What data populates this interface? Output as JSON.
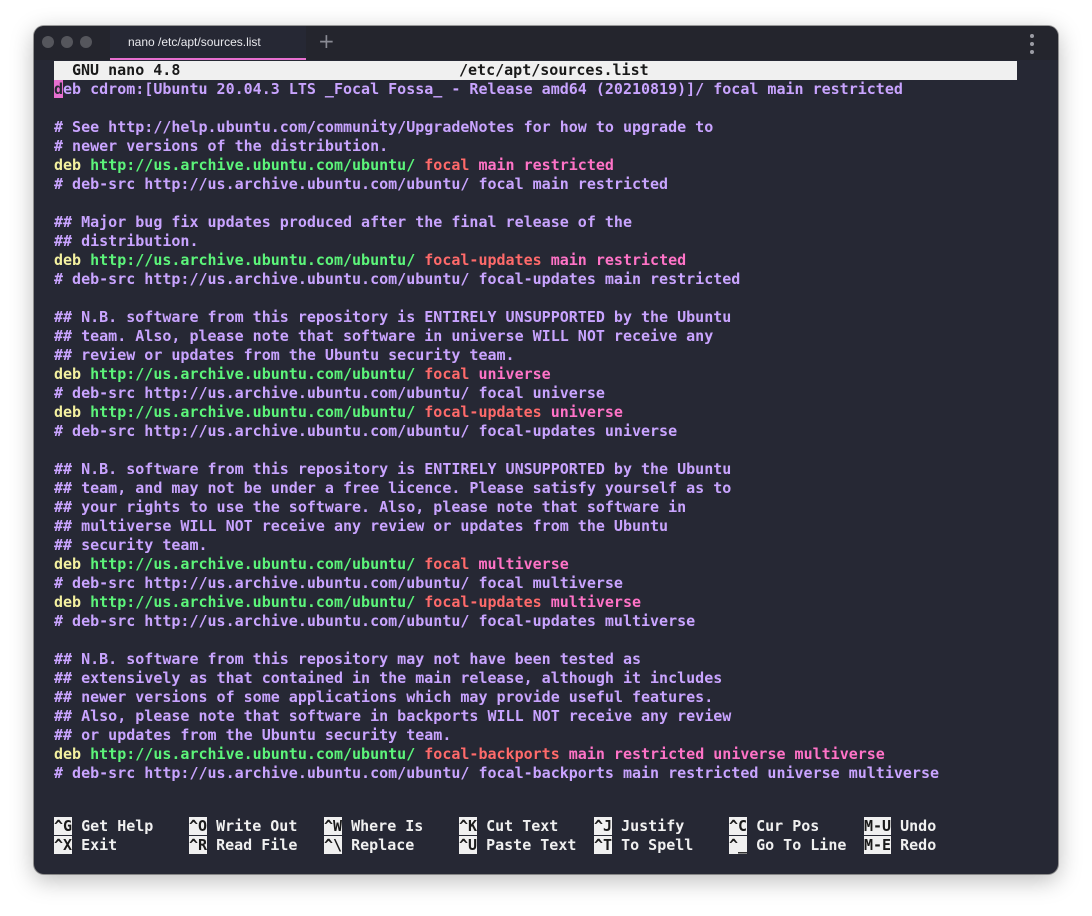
{
  "window": {
    "tab_title": "nano /etc/apt/sources.list",
    "new_tab": "+"
  },
  "nano": {
    "version": "GNU nano 4.8",
    "filename": "/etc/apt/sources.list"
  },
  "lines": [
    [
      {
        "t": "d",
        "c": "cursor"
      },
      {
        "t": "eb cdrom:[Ubuntu 20.04.3 LTS _Focal Fossa_ - Release amd64 (20210819)]/ focal main restricted",
        "c": "c-cdrom"
      }
    ],
    [],
    [
      {
        "t": "# See http://help.ubuntu.com/community/UpgradeNotes for how to upgrade to",
        "c": "c-comment"
      }
    ],
    [
      {
        "t": "# newer versions of the distribution.",
        "c": "c-comment"
      }
    ],
    [
      {
        "t": "deb ",
        "c": "c-deb"
      },
      {
        "t": "http://us.archive.ubuntu.com/ubuntu/ ",
        "c": "c-url"
      },
      {
        "t": "focal ",
        "c": "c-suite"
      },
      {
        "t": "main restricted",
        "c": "c-comp"
      }
    ],
    [
      {
        "t": "# deb-src http://us.archive.ubuntu.com/ubuntu/ focal main restricted",
        "c": "c-comment"
      }
    ],
    [],
    [
      {
        "t": "## Major bug fix updates produced after the final release of the",
        "c": "c-comment"
      }
    ],
    [
      {
        "t": "## distribution.",
        "c": "c-comment"
      }
    ],
    [
      {
        "t": "deb ",
        "c": "c-deb"
      },
      {
        "t": "http://us.archive.ubuntu.com/ubuntu/ ",
        "c": "c-url"
      },
      {
        "t": "focal-updates ",
        "c": "c-suite"
      },
      {
        "t": "main restricted",
        "c": "c-comp"
      }
    ],
    [
      {
        "t": "# deb-src http://us.archive.ubuntu.com/ubuntu/ focal-updates main restricted",
        "c": "c-comment"
      }
    ],
    [],
    [
      {
        "t": "## N.B. software from this repository is ENTIRELY UNSUPPORTED by the Ubuntu",
        "c": "c-comment"
      }
    ],
    [
      {
        "t": "## team. Also, please note that software in universe WILL NOT receive any",
        "c": "c-comment"
      }
    ],
    [
      {
        "t": "## review or updates from the Ubuntu security team.",
        "c": "c-comment"
      }
    ],
    [
      {
        "t": "deb ",
        "c": "c-deb"
      },
      {
        "t": "http://us.archive.ubuntu.com/ubuntu/ ",
        "c": "c-url"
      },
      {
        "t": "focal ",
        "c": "c-suite"
      },
      {
        "t": "universe",
        "c": "c-comp"
      }
    ],
    [
      {
        "t": "# deb-src http://us.archive.ubuntu.com/ubuntu/ focal universe",
        "c": "c-comment"
      }
    ],
    [
      {
        "t": "deb ",
        "c": "c-deb"
      },
      {
        "t": "http://us.archive.ubuntu.com/ubuntu/ ",
        "c": "c-url"
      },
      {
        "t": "focal-updates ",
        "c": "c-suite"
      },
      {
        "t": "universe",
        "c": "c-comp"
      }
    ],
    [
      {
        "t": "# deb-src http://us.archive.ubuntu.com/ubuntu/ focal-updates universe",
        "c": "c-comment"
      }
    ],
    [],
    [
      {
        "t": "## N.B. software from this repository is ENTIRELY UNSUPPORTED by the Ubuntu",
        "c": "c-comment"
      }
    ],
    [
      {
        "t": "## team, and may not be under a free licence. Please satisfy yourself as to",
        "c": "c-comment"
      }
    ],
    [
      {
        "t": "## your rights to use the software. Also, please note that software in",
        "c": "c-comment"
      }
    ],
    [
      {
        "t": "## multiverse WILL NOT receive any review or updates from the Ubuntu",
        "c": "c-comment"
      }
    ],
    [
      {
        "t": "## security team.",
        "c": "c-comment"
      }
    ],
    [
      {
        "t": "deb ",
        "c": "c-deb"
      },
      {
        "t": "http://us.archive.ubuntu.com/ubuntu/ ",
        "c": "c-url"
      },
      {
        "t": "focal ",
        "c": "c-suite"
      },
      {
        "t": "multiverse",
        "c": "c-comp"
      }
    ],
    [
      {
        "t": "# deb-src http://us.archive.ubuntu.com/ubuntu/ focal multiverse",
        "c": "c-comment"
      }
    ],
    [
      {
        "t": "deb ",
        "c": "c-deb"
      },
      {
        "t": "http://us.archive.ubuntu.com/ubuntu/ ",
        "c": "c-url"
      },
      {
        "t": "focal-updates ",
        "c": "c-suite"
      },
      {
        "t": "multiverse",
        "c": "c-comp"
      }
    ],
    [
      {
        "t": "# deb-src http://us.archive.ubuntu.com/ubuntu/ focal-updates multiverse",
        "c": "c-comment"
      }
    ],
    [],
    [
      {
        "t": "## N.B. software from this repository may not have been tested as",
        "c": "c-comment"
      }
    ],
    [
      {
        "t": "## extensively as that contained in the main release, although it includes",
        "c": "c-comment"
      }
    ],
    [
      {
        "t": "## newer versions of some applications which may provide useful features.",
        "c": "c-comment"
      }
    ],
    [
      {
        "t": "## Also, please note that software in backports WILL NOT receive any review",
        "c": "c-comment"
      }
    ],
    [
      {
        "t": "## or updates from the Ubuntu security team.",
        "c": "c-comment"
      }
    ],
    [
      {
        "t": "deb ",
        "c": "c-deb"
      },
      {
        "t": "http://us.archive.ubuntu.com/ubuntu/ ",
        "c": "c-url"
      },
      {
        "t": "focal-backports ",
        "c": "c-suite"
      },
      {
        "t": "main restricted universe multiverse",
        "c": "c-comp"
      }
    ],
    [
      {
        "t": "# deb-src http://us.archive.ubuntu.com/ubuntu/ focal-backports main restricted universe multiverse",
        "c": "c-comment"
      }
    ]
  ],
  "shortcuts": [
    [
      {
        "key": "^G",
        "label": "Get Help"
      },
      {
        "key": "^X",
        "label": "Exit"
      }
    ],
    [
      {
        "key": "^O",
        "label": "Write Out"
      },
      {
        "key": "^R",
        "label": "Read File"
      }
    ],
    [
      {
        "key": "^W",
        "label": "Where Is"
      },
      {
        "key": "^\\",
        "label": "Replace"
      }
    ],
    [
      {
        "key": "^K",
        "label": "Cut Text"
      },
      {
        "key": "^U",
        "label": "Paste Text"
      }
    ],
    [
      {
        "key": "^J",
        "label": "Justify"
      },
      {
        "key": "^T",
        "label": "To Spell"
      }
    ],
    [
      {
        "key": "^C",
        "label": "Cur Pos"
      },
      {
        "key": "^_",
        "label": "Go To Line"
      }
    ],
    [
      {
        "key": "M-U",
        "label": "Undo"
      },
      {
        "key": "M-E",
        "label": "Redo"
      }
    ]
  ]
}
